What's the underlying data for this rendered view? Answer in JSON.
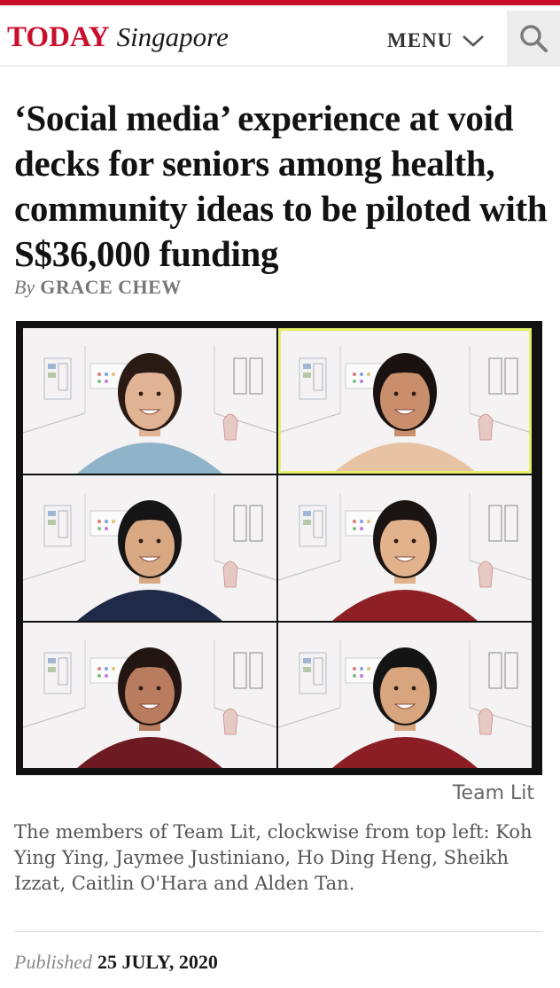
{
  "header": {
    "brand_primary": "TODAY",
    "brand_secondary": "Singapore",
    "menu_label": "MENU",
    "accent_color": "#c8102e"
  },
  "article": {
    "headline": "‘Social media’ experience at void decks for seniors among health, community ideas to be piloted with S$36,000 funding",
    "by_label": "By",
    "author": "GRACE CHEW",
    "photo_credit": "Team Lit",
    "caption": "The members of Team Lit, clockwise from top left: Koh Ying Ying, Jaymee Justiniano, Ho Ding Heng, Sheikh Izzat, Caitlin O'Hara and Alden Tan.",
    "published_label": "Published",
    "published_date": "25 JULY, 2020"
  },
  "photo": {
    "tiles": [
      {
        "shirt": "#8fb3c8",
        "hair": "#2a1a14",
        "skin": "#e0b394",
        "active": false
      },
      {
        "shirt": "#e7c3a3",
        "hair": "#1a1210",
        "skin": "#c98f6d",
        "active": true
      },
      {
        "shirt": "#1f2a48",
        "hair": "#151515",
        "skin": "#d8a883",
        "active": false
      },
      {
        "shirt": "#8e1f24",
        "hair": "#1a1412",
        "skin": "#e2b28c",
        "active": false
      },
      {
        "shirt": "#6e1a22",
        "hair": "#231612",
        "skin": "#b97c5e",
        "active": false
      },
      {
        "shirt": "#8a1e24",
        "hair": "#141414",
        "skin": "#d9a57f",
        "active": false
      }
    ]
  }
}
